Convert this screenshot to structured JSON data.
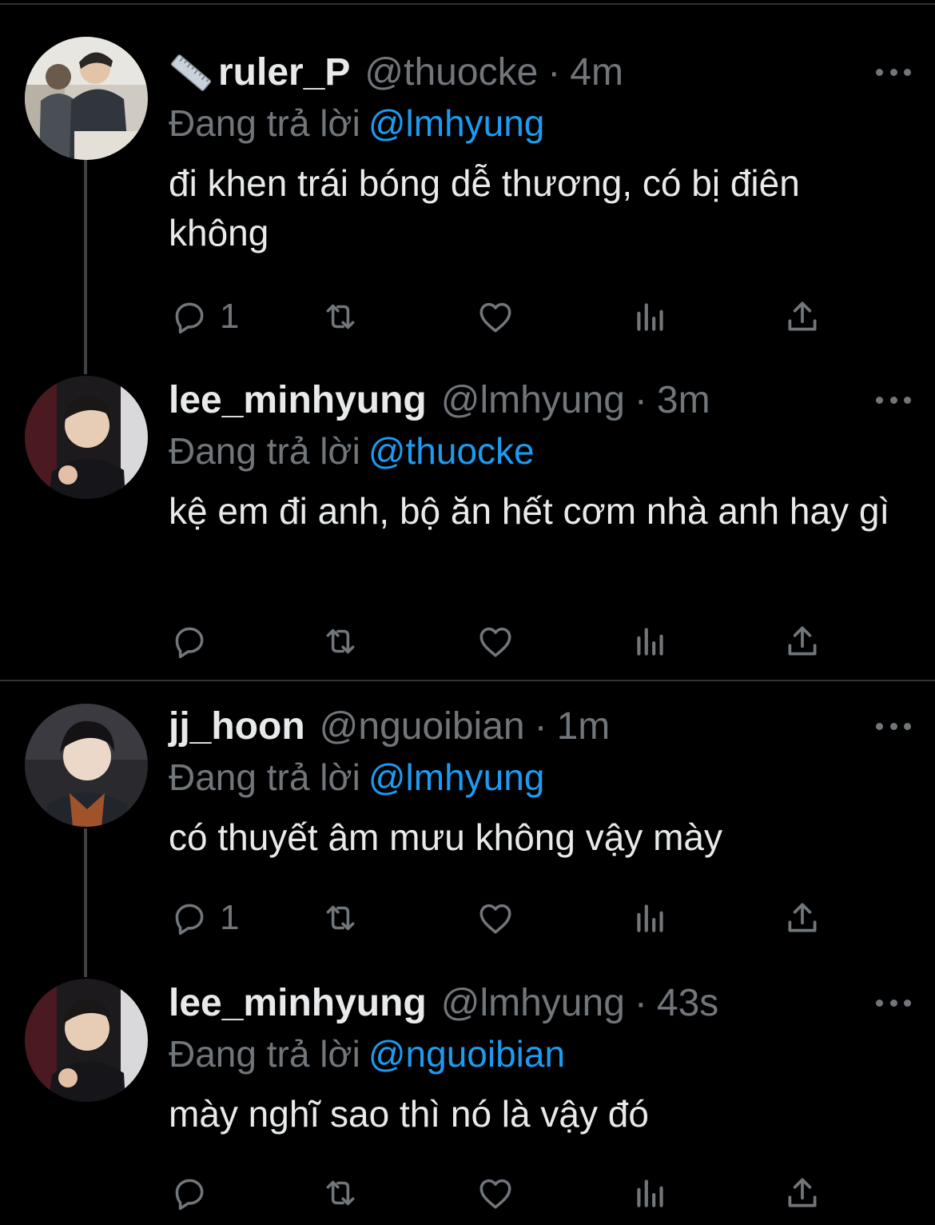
{
  "tweets": [
    {
      "name": "ruler_P",
      "name_icon": "ruler-icon",
      "handle": "@thuocke",
      "time": "4m",
      "replying_label": "Đang trả lời",
      "replying_to": "@lmhyung",
      "text": "đi khen trái bóng dễ thương, có bị điên không",
      "reply_count": "1"
    },
    {
      "name": "lee_minhyung",
      "handle": "@lmhyung",
      "time": "3m",
      "replying_label": "Đang trả lời",
      "replying_to": "@thuocke",
      "text": "kệ em đi anh, bộ ăn hết cơm nhà anh hay gì",
      "reply_count": ""
    },
    {
      "name": "jj_hoon",
      "handle": "@nguoibian",
      "time": "1m",
      "replying_label": "Đang trả lời",
      "replying_to": "@lmhyung",
      "text": "có thuyết âm mưu không vậy mày",
      "reply_count": "1"
    },
    {
      "name": "lee_minhyung",
      "handle": "@lmhyung",
      "time": "43s",
      "replying_label": "Đang trả lời",
      "replying_to": "@nguoibian",
      "text": "mày nghĩ sao thì nó là vậy đó",
      "reply_count": ""
    }
  ],
  "separator": "·",
  "colors": {
    "background": "#000000",
    "text": "#e7e9ea",
    "muted": "#71767b",
    "link": "#1d9bf0"
  }
}
